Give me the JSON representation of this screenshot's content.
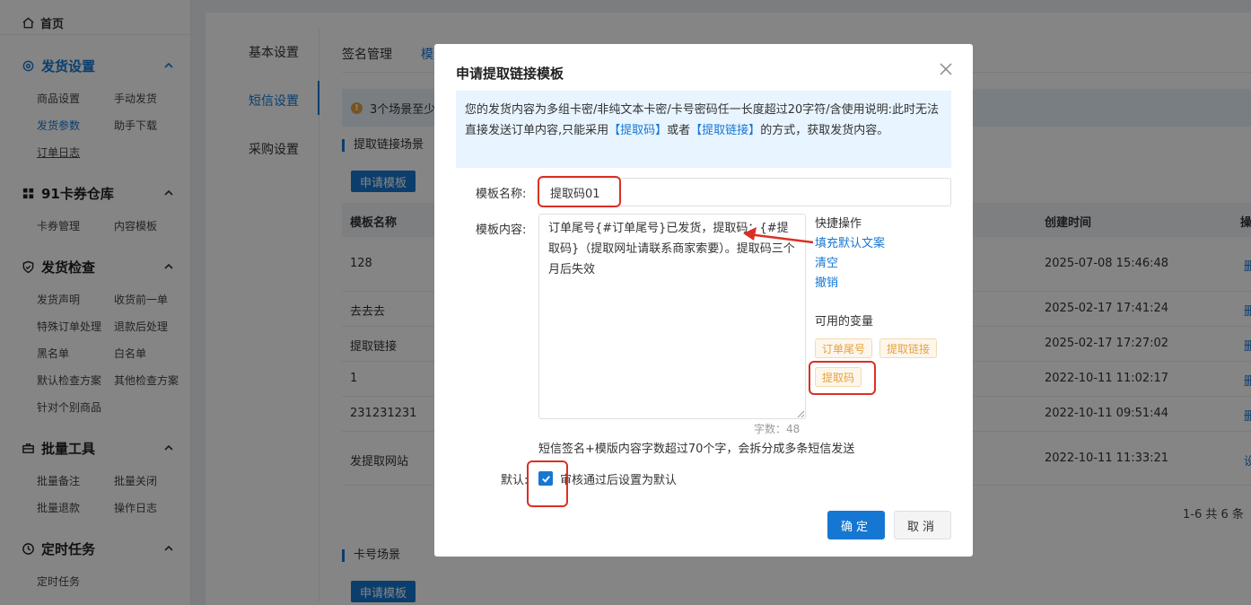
{
  "sidebar": {
    "home": "首页",
    "sections": [
      {
        "title": "发货设置",
        "icon": "gear-icon",
        "items": [
          "商品设置",
          "手动发货",
          "发货参数",
          "助手下载",
          "订单日志"
        ]
      },
      {
        "title": "91卡券仓库",
        "icon": "grid-icon",
        "items": [
          "卡券管理",
          "内容模板"
        ]
      },
      {
        "title": "发货检查",
        "icon": "shield-icon",
        "items": [
          "发货声明",
          "收货前一单",
          "特殊订单处理",
          "退款后处理",
          "黑名单",
          "白名单",
          "默认检查方案",
          "其他检查方案",
          "针对个别商品"
        ]
      },
      {
        "title": "批量工具",
        "icon": "toolbox-icon",
        "items": [
          "批量备注",
          "批量关闭",
          "批量退款",
          "操作日志"
        ]
      },
      {
        "title": "定时任务",
        "icon": "clock-icon",
        "items": [
          "定时任务"
        ]
      }
    ]
  },
  "leftnav": [
    "基本设置",
    "短信设置",
    "采购设置"
  ],
  "tabs": [
    "签名管理",
    "模"
  ],
  "notice": "3个场景至少",
  "section1": "提取链接场景",
  "section2": "卡号场景",
  "apply_label": "申请模板",
  "table": {
    "headers": [
      "模板名称",
      "创建时间",
      "操"
    ],
    "rows": [
      {
        "name": "128",
        "time": "2025-07-08 15:46:48",
        "op": "删"
      },
      {
        "name": "去去去",
        "time": "2025-02-17 17:41:24",
        "op": "删"
      },
      {
        "name": "提取链接",
        "time": "2025-02-17 17:27:02",
        "op": "删"
      },
      {
        "name": "1",
        "time": "2022-10-11 11:02:17",
        "op": "删"
      },
      {
        "name": "231231231",
        "time": "2022-10-11 09:51:44",
        "op": "删"
      },
      {
        "name": "发提取网站",
        "time": "2022-10-11 11:33:21",
        "op": "设"
      }
    ],
    "pager": "1-6 共 6 条"
  },
  "dialog": {
    "title": "申请提取链接模板",
    "info_a": "您的发货内容为多组卡密/非纯文本卡密/卡号密码任一长度超过20字符/含使用说明:此时无法直接发送订单内容,只能采用",
    "info_hl1": "【提取码】",
    "info_b": "或者",
    "info_hl2": "【提取链接】",
    "info_c": "的方式，获取发货内容。",
    "name_label": "模板名称:",
    "name_value": "提取码01",
    "content_label": "模板内容:",
    "content_value": "订单尾号{#订单尾号}已发货，提取码：{#提取码}（提取网址请联系商家索要）。提取码三个月后失效",
    "count": "字数：48",
    "hint": "短信签名+模版内容字数超过70个字，会拆分成多条短信发送",
    "quick_title": "快捷操作",
    "quick_links": [
      "填充默认文案",
      "清空",
      "撤销"
    ],
    "vars_title": "可用的变量",
    "vars": [
      "订单尾号",
      "提取链接",
      "提取码"
    ],
    "default_label": "默认:",
    "default_text": "审核通过后设置为默认",
    "ok": "确定",
    "cancel": "取消"
  },
  "colors": {
    "primary": "#1677d2",
    "annotation": "#d93025",
    "tag": "#e6a23c"
  }
}
